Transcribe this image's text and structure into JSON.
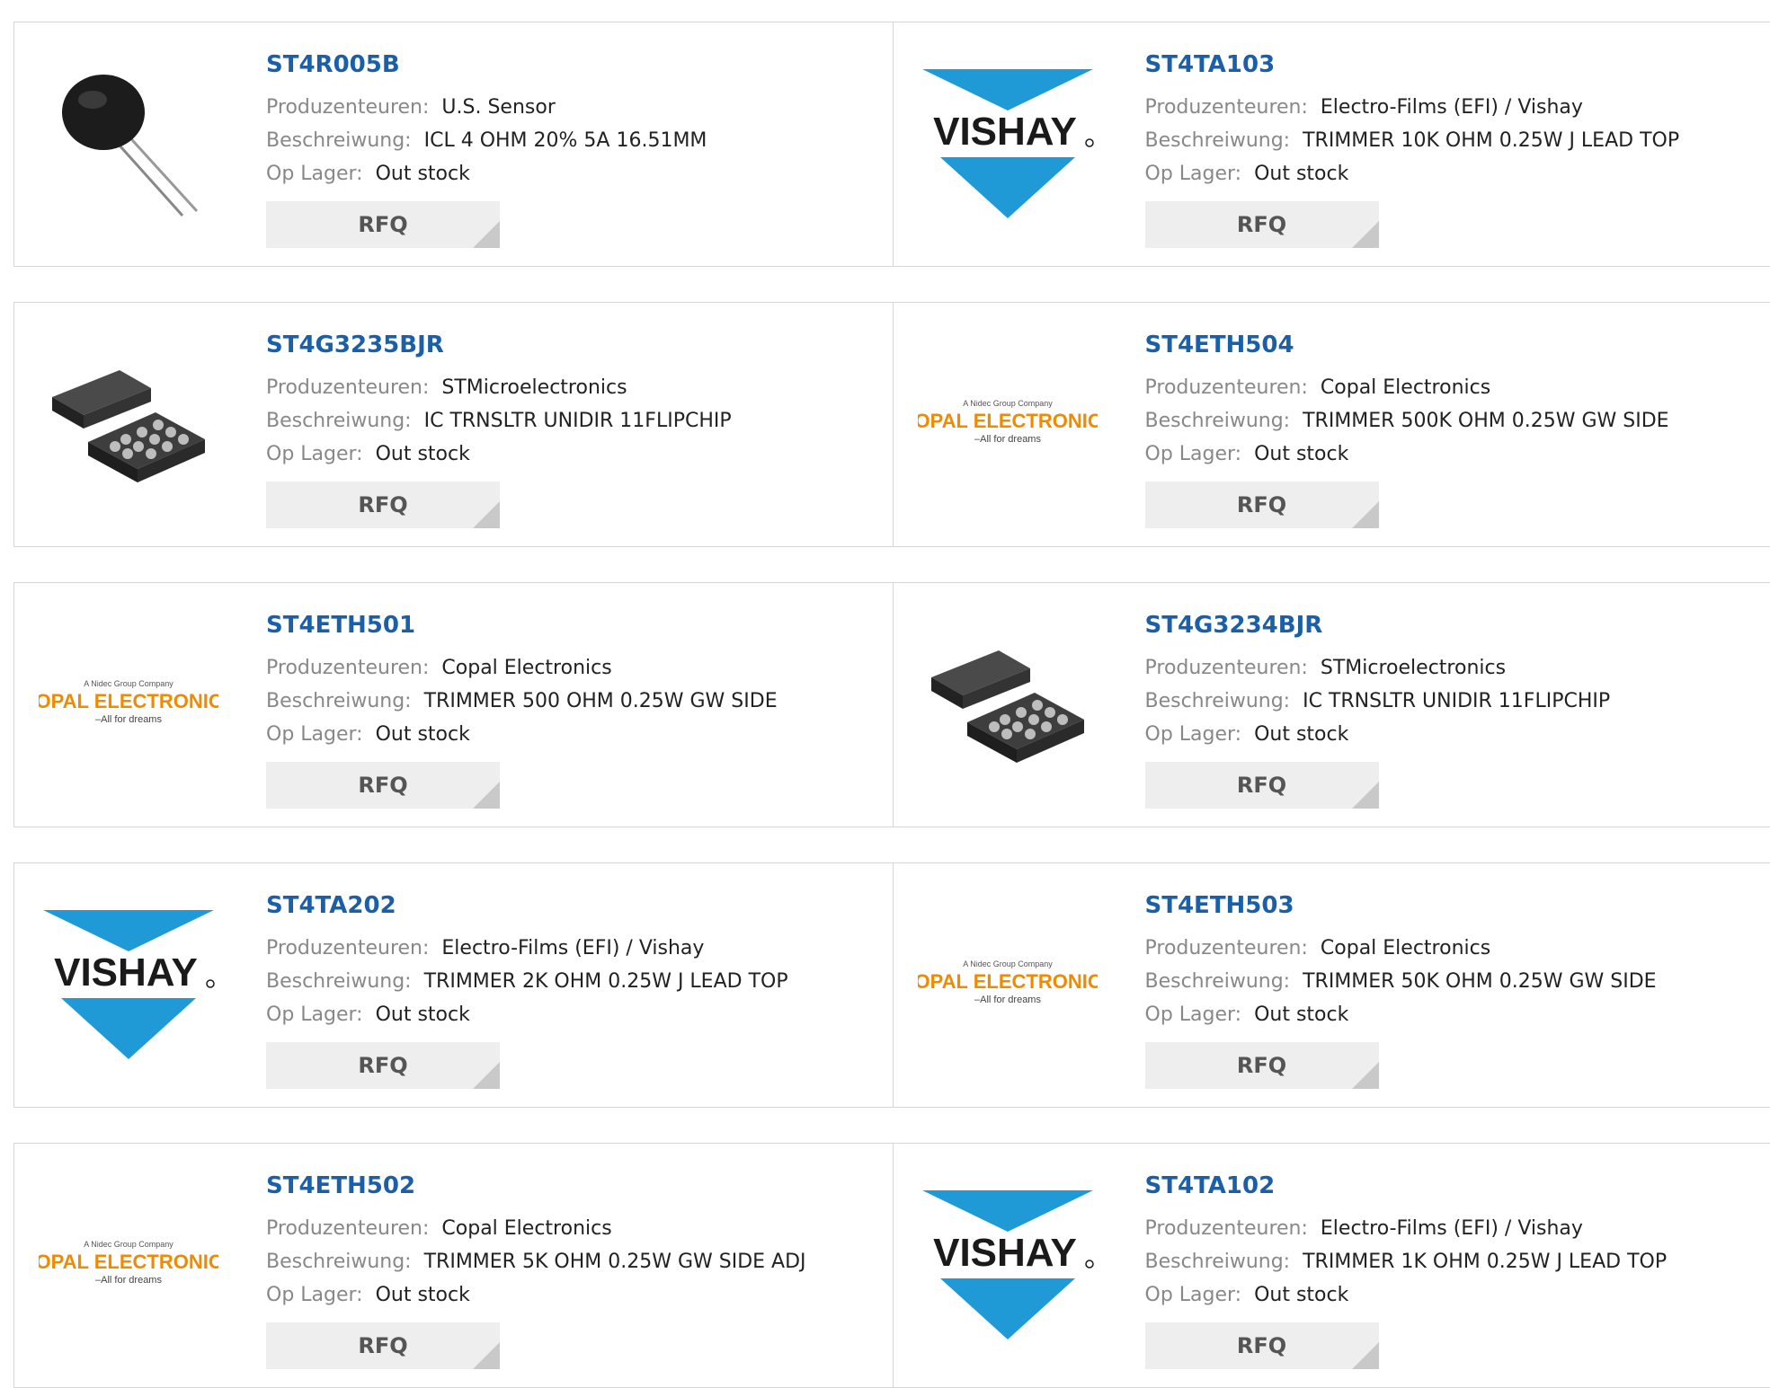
{
  "labels": {
    "manufacturer": "Produzenteuren:",
    "description": "Beschreiwung:",
    "stock": "Op Lager:",
    "rfq": "RFQ"
  },
  "logos": {
    "vishay": "VISHAY",
    "copal_top": "A Nidec Group Company",
    "copal_main": "COPAL ELECTRONICS",
    "copal_tag": "–All for dreams"
  },
  "colors": {
    "link": "#1a5fa8",
    "vishay_blue": "#1f9ad6",
    "copal_orange": "#f08a00",
    "nidec_green": "#2aa84a"
  },
  "products": [
    {
      "pn": "ST4R005B",
      "manufacturer": "U.S. Sensor",
      "description": "ICL 4 OHM 20% 5A 16.51MM",
      "stock": "Out stock",
      "image": "thermistor"
    },
    {
      "pn": "ST4TA103",
      "manufacturer": "Electro-Films (EFI) / Vishay",
      "description": "TRIMMER 10K OHM 0.25W J LEAD TOP",
      "stock": "Out stock",
      "image": "vishay-logo"
    },
    {
      "pn": "ST4G3235BJR",
      "manufacturer": "STMicroelectronics",
      "description": "IC TRNSLTR UNIDIR 11FLIPCHIP",
      "stock": "Out stock",
      "image": "flipchip"
    },
    {
      "pn": "ST4ETH504",
      "manufacturer": "Copal Electronics",
      "description": "TRIMMER 500K OHM 0.25W GW SIDE",
      "stock": "Out stock",
      "image": "copal-logo"
    },
    {
      "pn": "ST4ETH501",
      "manufacturer": "Copal Electronics",
      "description": "TRIMMER 500 OHM 0.25W GW SIDE",
      "stock": "Out stock",
      "image": "copal-logo"
    },
    {
      "pn": "ST4G3234BJR",
      "manufacturer": "STMicroelectronics",
      "description": "IC TRNSLTR UNIDIR 11FLIPCHIP",
      "stock": "Out stock",
      "image": "flipchip"
    },
    {
      "pn": "ST4TA202",
      "manufacturer": "Electro-Films (EFI) / Vishay",
      "description": "TRIMMER 2K OHM 0.25W J LEAD TOP",
      "stock": "Out stock",
      "image": "vishay-logo"
    },
    {
      "pn": "ST4ETH503",
      "manufacturer": "Copal Electronics",
      "description": "TRIMMER 50K OHM 0.25W GW SIDE",
      "stock": "Out stock",
      "image": "copal-logo"
    },
    {
      "pn": "ST4ETH502",
      "manufacturer": "Copal Electronics",
      "description": "TRIMMER 5K OHM 0.25W GW SIDE ADJ",
      "stock": "Out stock",
      "image": "copal-logo"
    },
    {
      "pn": "ST4TA102",
      "manufacturer": "Electro-Films (EFI) / Vishay",
      "description": "TRIMMER 1K OHM 0.25W J LEAD TOP",
      "stock": "Out stock",
      "image": "vishay-logo"
    }
  ]
}
